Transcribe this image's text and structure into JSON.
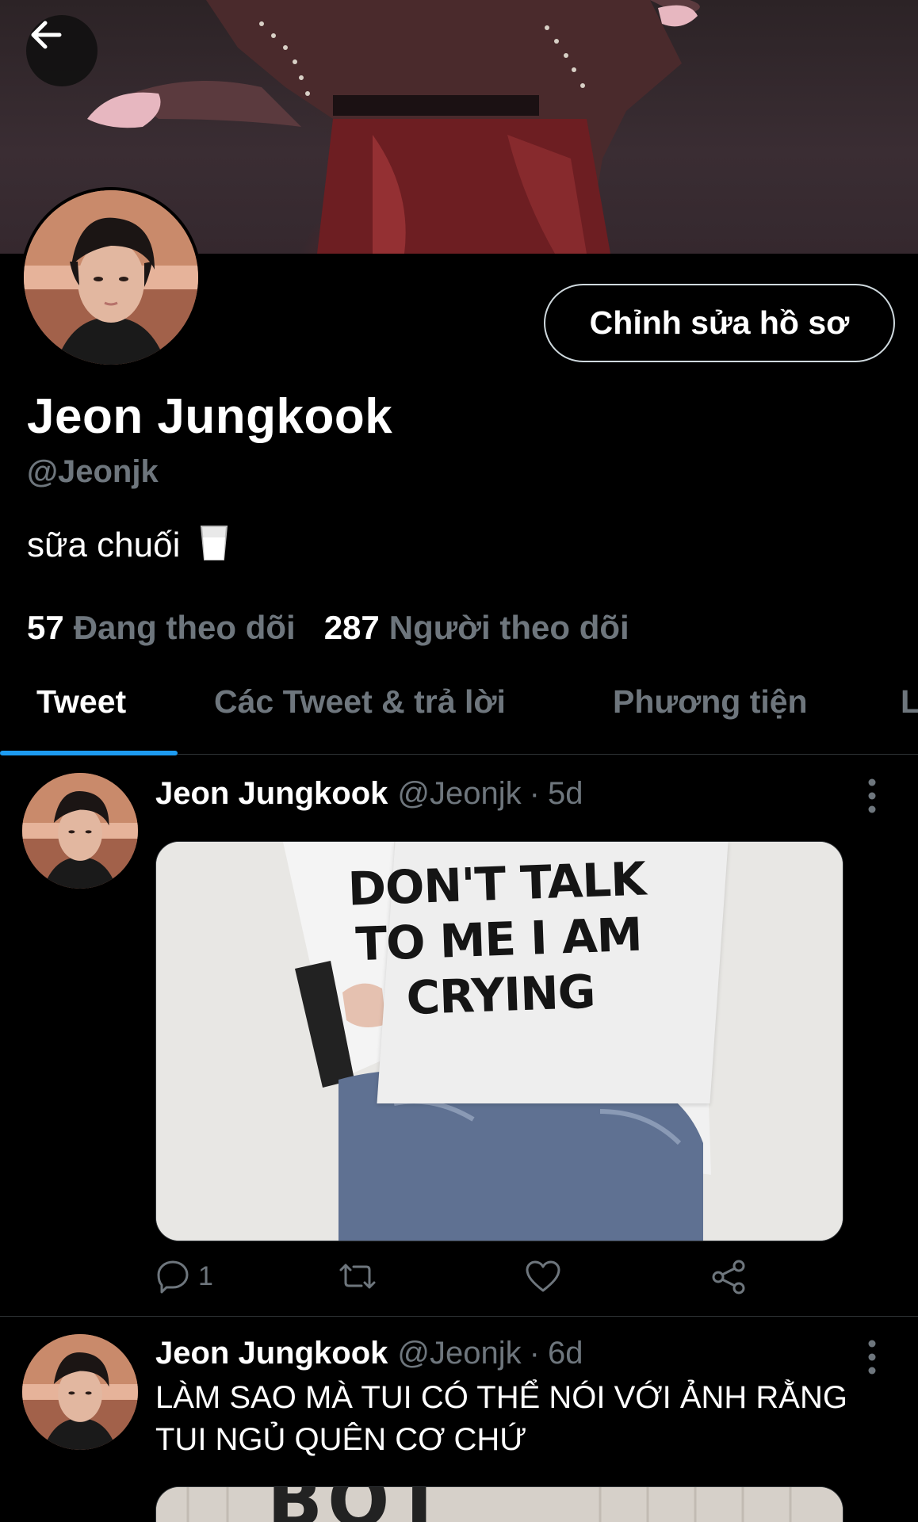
{
  "profile": {
    "name": "Jeon Jungkook",
    "handle": "@Jeonjk",
    "bio": "sữa chuối",
    "edit_button": "Chỉnh sửa hồ sơ",
    "following_count": "57",
    "following_label": "Đang theo dõi",
    "followers_count": "287",
    "followers_label": "Người theo dõi"
  },
  "tabs": [
    {
      "label": "Tweet",
      "active": true
    },
    {
      "label": "Các Tweet & trả lời",
      "active": false
    },
    {
      "label": "Phương tiện",
      "active": false
    },
    {
      "label": "L",
      "active": false
    }
  ],
  "tweets": [
    {
      "name": "Jeon Jungkook",
      "handle": "@Jeonjk",
      "separator": "·",
      "time": "5d",
      "image_text": [
        "DON'T TALK",
        "TO ME I AM",
        "CRYING"
      ],
      "reply_count": "1"
    },
    {
      "name": "Jeon Jungkook",
      "handle": "@Jeonjk",
      "separator": "·",
      "time": "6d",
      "text": "LÀM SAO MÀ TUI CÓ THỂ NÓI VỚI ẢNH RẰNG TUI NGỦ QUÊN CƠ CHỨ",
      "image_text": "BOT"
    }
  ],
  "colors": {
    "accent": "#1d9bf0",
    "muted": "#6e767d",
    "background": "#000000"
  }
}
